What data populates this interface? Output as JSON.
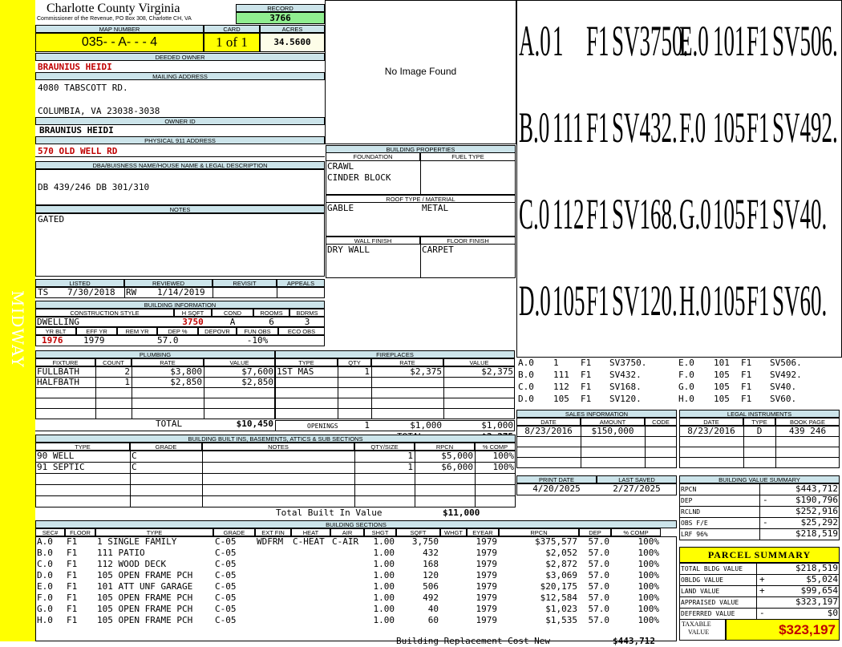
{
  "sidebar": {
    "label": "MIDWAY"
  },
  "county": {
    "title": "Charlotte County Virginia",
    "subtitle": "Commissioner of the Revenue, PO Box 308, Charlotte CH, VA"
  },
  "record": {
    "label": "RECORD",
    "value": "3766"
  },
  "map": {
    "label": "MAP NUMBER",
    "value": "035- - A- - - 4",
    "card_label": "CARD",
    "card_value": "1 of 1",
    "acres_label": "ACRES",
    "acres_value": "34.5600"
  },
  "owner": {
    "deeded_label": "DEEDED OWNER",
    "deeded": "BRAUNIUS HEIDI",
    "mailing_label": "MAILING ADDRESS",
    "mail1": "4080 TABSCOTT RD.",
    "mail2": "COLUMBIA, VA 23038-3038",
    "id_label": "OWNER ID",
    "id_value": "BRAUNIUS HEIDI",
    "phys_label": "PHYSICAL 911 ADDRESS",
    "phys_value": "570 OLD WELL RD"
  },
  "legal": {
    "label": "DBA/BUISNESS NAME/HOUSE NAME & LEGAL DESCRIPTION",
    "value": "DB 439/246 DB 301/310"
  },
  "notes": {
    "label": "NOTES",
    "value": "GATED"
  },
  "image": {
    "placeholder": "No Image Found"
  },
  "building_props": {
    "label": "BUILDING PROPERTIES",
    "foundation_label": "FOUNDATION",
    "fuel_label": "FUEL TYPE",
    "foundation1": "CRAWL",
    "foundation2": "CINDER BLOCK",
    "roof_label": "ROOF TYPE / MATERIAL",
    "roof_type": "GABLE",
    "roof_material": "METAL",
    "wall_label": "WALL FINISH",
    "floor_label": "FLOOR FINISH",
    "wall": "DRY WALL",
    "floor": "CARPET"
  },
  "sketch": {
    "rows": [
      [
        "A.0",
        "1",
        "F1",
        "SV3750.",
        "E.0",
        "101",
        "F1",
        "SV506."
      ],
      [
        "B.0",
        "111",
        "F1",
        "SV432.",
        "F.0",
        "105",
        "F1",
        "SV492."
      ],
      [
        "C.0",
        "112",
        "F1",
        "SV168.",
        "G.0",
        "105",
        "F1",
        "SV40."
      ],
      [
        "D.0",
        "105",
        "F1",
        "SV120.",
        "H.0",
        "105",
        "F1",
        "SV60."
      ]
    ]
  },
  "listing": {
    "listed_label": "LISTED",
    "reviewed_label": "REVIEWED",
    "revisit_label": "REVISIT",
    "appeals_label": "APPEALS",
    "listed_by": "TS",
    "listed_date": "7/30/2018",
    "reviewed_by": "RW",
    "reviewed_date": "1/14/2019"
  },
  "building_info": {
    "label": "BUILDING INFORMATION",
    "style_label": "CONSTRUCTION STYLE",
    "hsqft_label": "H SQFT",
    "cond_label": "COND",
    "rooms_label": "ROOMS",
    "bdrms_label": "BDRMS",
    "style": "DWELLING",
    "hsqft": "3750",
    "cond": "A",
    "rooms": "6",
    "bdrms": "3",
    "yrblt_label": "YR BLT",
    "effyr_label": "EFF YR",
    "remyr_label": "REM YR",
    "dep_label": "DEP %",
    "depovr_label": "DEPOVR",
    "funobs_label": "FUN OBS",
    "ecoobs_label": "ECO OBS",
    "yrblt": "1976",
    "effyr": "1979",
    "dep": "57.0",
    "funobs": "-10%"
  },
  "plumbing": {
    "label": "PLUMBING",
    "headers": [
      "FIXTURE",
      "COUNT",
      "RATE",
      "VALUE"
    ],
    "rows": [
      [
        "FULLBATH",
        "2",
        "$3,800",
        "$7,600"
      ],
      [
        "HALFBATH",
        "1",
        "$2,850",
        "$2,850"
      ]
    ],
    "total_label": "TOTAL",
    "total": "$10,450"
  },
  "fireplaces": {
    "label": "FIREPLACES",
    "headers": [
      "TYPE",
      "QTY",
      "RATE",
      "VALUE"
    ],
    "rows": [
      [
        "1ST MAS",
        "1",
        "$2,375",
        "$2,375"
      ]
    ],
    "openings_label": "OPENINGS",
    "openings_qty": "1",
    "openings_rate": "$1,000",
    "openings_value": "$1,000",
    "total_label": "TOTAL",
    "total": "$3,375"
  },
  "sales": {
    "label": "SALES INFORMATION",
    "headers": [
      "DATE",
      "AMOUNT",
      "CODE"
    ],
    "date": "8/23/2016",
    "amount": "$150,000"
  },
  "legal_inst": {
    "label": "LEGAL INSTRUMENTS",
    "headers": [
      "DATE",
      "TYPE",
      "BOOK PAGE"
    ],
    "date": "8/23/2016",
    "type": "D",
    "book": "439 246"
  },
  "builtins": {
    "label": "BUILDING BUILT INS, BASEMENTS, ATTICS & SUB SECTIONS",
    "headers": [
      "TYPE",
      "GRADE",
      "NOTES",
      "QTY/SIZE",
      "RPCN",
      "% COMP"
    ],
    "rows": [
      [
        "90 WELL",
        "C",
        "",
        "1",
        "$5,000",
        "100%"
      ],
      [
        "91 SEPTIC",
        "C",
        "",
        "1",
        "$6,000",
        "100%"
      ]
    ],
    "total_label": "Total Built In Value",
    "total": "$11,000"
  },
  "print": {
    "print_label": "PRINT DATE",
    "saved_label": "LAST SAVED",
    "print_date": "4/20/2025",
    "saved_date": "2/27/2025"
  },
  "value_summary": {
    "label": "BUILDING VALUE SUMMARY",
    "rows": [
      [
        "RPCN",
        "",
        "$443,712"
      ],
      [
        "DEP",
        "-",
        "$190,796"
      ],
      [
        "RCLND",
        "",
        "$252,916"
      ],
      [
        "OBS F/E",
        "-",
        "$25,292"
      ],
      [
        "LRF 96%",
        "",
        "$218,519"
      ]
    ]
  },
  "sections": {
    "label": "BUILDING SECTIONS",
    "headers": [
      "SEC#",
      "FLOOR",
      "TYPE",
      "GRADE",
      "EXT FIN",
      "HEAT",
      "AIR",
      "SHGT",
      "SQFT",
      "WHGT",
      "EYEAR",
      "RPCN",
      "DEP",
      "% COMP"
    ],
    "rows": [
      [
        "A.0",
        "F1",
        "1 SINGLE FAMILY",
        "C-05",
        "WDFRM",
        "C-HEAT",
        "C-AIR",
        "1.00",
        "3,750",
        "",
        "1979",
        "$375,577",
        "57.0",
        "100%"
      ],
      [
        "B.0",
        "F1",
        "111 PATIO",
        "C-05",
        "",
        "",
        "",
        "1.00",
        "432",
        "",
        "1979",
        "$2,052",
        "57.0",
        "100%"
      ],
      [
        "C.0",
        "F1",
        "112 WOOD DECK",
        "C-05",
        "",
        "",
        "",
        "1.00",
        "168",
        "",
        "1979",
        "$2,872",
        "57.0",
        "100%"
      ],
      [
        "D.0",
        "F1",
        "105 OPEN FRAME PCH",
        "C-05",
        "",
        "",
        "",
        "1.00",
        "120",
        "",
        "1979",
        "$3,069",
        "57.0",
        "100%"
      ],
      [
        "E.0",
        "F1",
        "101 ATT UNF GARAGE",
        "C-05",
        "",
        "",
        "",
        "1.00",
        "506",
        "",
        "1979",
        "$20,175",
        "57.0",
        "100%"
      ],
      [
        "F.0",
        "F1",
        "105 OPEN FRAME PCH",
        "C-05",
        "",
        "",
        "",
        "1.00",
        "492",
        "",
        "1979",
        "$12,584",
        "57.0",
        "100%"
      ],
      [
        "G.0",
        "F1",
        "105 OPEN FRAME PCH",
        "C-05",
        "",
        "",
        "",
        "1.00",
        "40",
        "",
        "1979",
        "$1,023",
        "57.0",
        "100%"
      ],
      [
        "H.0",
        "F1",
        "105 OPEN FRAME PCH",
        "C-05",
        "",
        "",
        "",
        "1.00",
        "60",
        "",
        "1979",
        "$1,535",
        "57.0",
        "100%"
      ]
    ],
    "total_label": "Building Replacement Cost New",
    "total": "$443,712"
  },
  "parcel": {
    "label": "PARCEL SUMMARY",
    "rows": [
      [
        "TOTAL BLDG VALUE",
        "",
        "$218,519"
      ],
      [
        "OBLDG VALUE",
        "+",
        "$5,024"
      ],
      [
        "LAND VALUE",
        "+",
        "$99,654"
      ],
      [
        "APPRAISED VALUE",
        "",
        "$323,197"
      ],
      [
        "DEFERRED VALUE",
        "-",
        "$0"
      ]
    ],
    "taxable_label1": "TAXABLE",
    "taxable_label2": "VALUE",
    "taxable": "$323,197"
  }
}
